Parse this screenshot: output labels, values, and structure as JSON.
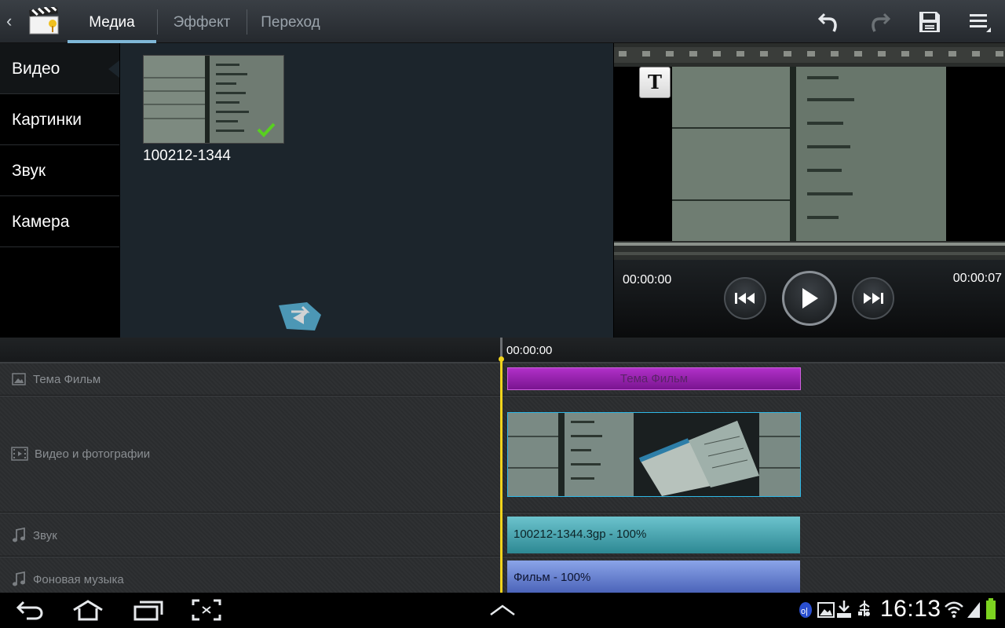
{
  "actionbar": {
    "tabs": [
      {
        "label": "Медиа",
        "active": true
      },
      {
        "label": "Эффект",
        "active": false
      },
      {
        "label": "Переход",
        "active": false
      }
    ]
  },
  "sidebar": {
    "items": [
      {
        "label": "Видео",
        "selected": true
      },
      {
        "label": "Картинки",
        "selected": false
      },
      {
        "label": "Звук",
        "selected": false
      },
      {
        "label": "Камера",
        "selected": false
      }
    ]
  },
  "media": {
    "items": [
      {
        "label": "100212-1344",
        "checked": true
      }
    ]
  },
  "preview": {
    "text_button": "T",
    "time_current": "00:00:00",
    "time_total": "00:00:07"
  },
  "timeline": {
    "ruler_time": "00:00:00",
    "tracks": [
      {
        "label": "Тема Фильм",
        "clip": "Тема Фильм",
        "icon": "image-icon"
      },
      {
        "label": "Видео и фотографии",
        "icon": "film-icon"
      },
      {
        "label": "Звук",
        "clip": "100212-1344.3gp - 100%",
        "icon": "music-note-icon"
      },
      {
        "label": "Фоновая музыка",
        "clip": "Фильм - 100%",
        "icon": "music-note-icon"
      }
    ]
  },
  "statusbar": {
    "clock": "16:13"
  },
  "colors": {
    "accent": "#7fb8d8",
    "playhead": "#f2d41c",
    "theme_clip": "#a028b8",
    "audio_clip": "#3d9aa5",
    "music_clip": "#6a82d0",
    "battery": "#7cd320"
  }
}
